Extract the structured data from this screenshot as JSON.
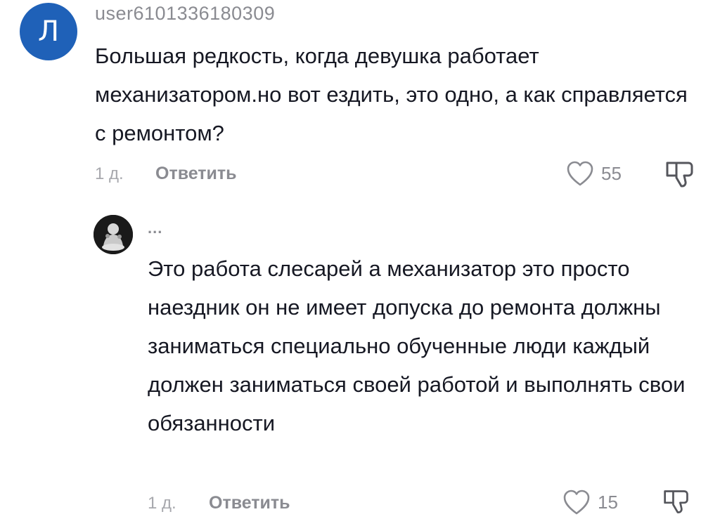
{
  "comment1": {
    "avatar_letter": "Л",
    "username": "user6101336180309",
    "text": "Большая редкость, когда девушка работает механизатором.но вот ездить, это одно, а как справляется с ремонтом?",
    "time": "1 д.",
    "reply_label": "Ответить",
    "likes": "55",
    "avatar_color": "#1f61b8"
  },
  "comment2": {
    "username": "...",
    "text": "Это работа слесарей а механизатор это просто наездник он не имеет допуска до ремонта должны заниматься специально обученные люди каждый должен заниматься своей работой и выполнять свои обязанности",
    "time": "1 д.",
    "reply_label": "Ответить",
    "likes": "15"
  },
  "icons": {
    "like": "heart-outline-icon",
    "dislike": "thumbs-down-icon"
  }
}
